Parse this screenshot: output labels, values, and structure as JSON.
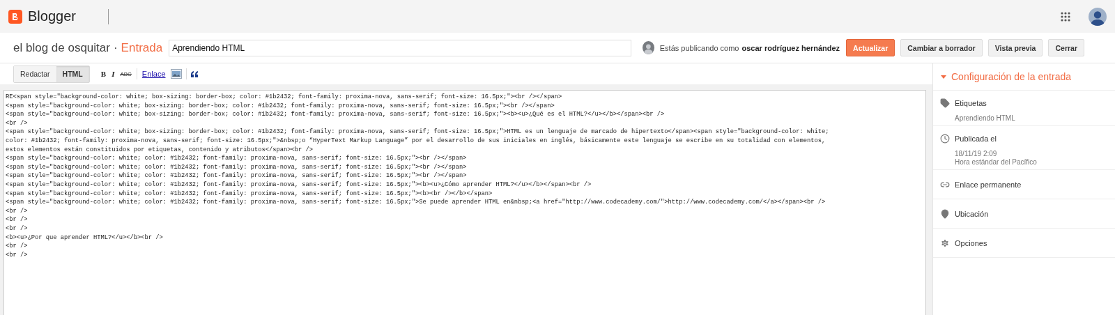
{
  "app_bar": {
    "brand": "Blogger"
  },
  "header": {
    "blog_name": "el blog de osquitar",
    "separator": "·",
    "section": "Entrada",
    "title_value": "Aprendiendo HTML",
    "publishing_prefix": "Estás publicando como",
    "publishing_name": "oscar rodríguez hernández",
    "buttons": [
      {
        "label": "Actualizar",
        "kind": "primary"
      },
      {
        "label": "Cambiar a borrador",
        "kind": "default"
      },
      {
        "label": "Vista previa",
        "kind": "default"
      },
      {
        "label": "Cerrar",
        "kind": "default"
      }
    ]
  },
  "toolbar": {
    "modes": [
      {
        "label": "Redactar",
        "selected": false
      },
      {
        "label": "HTML",
        "selected": true
      }
    ],
    "bold": "B",
    "italic": "I",
    "strike": "ABC",
    "link": "Enlace"
  },
  "editor": {
    "lines": [
      "RE<span style=\"background-color: white; box-sizing: border-box; color: #1b2432; font-family: proxima-nova, sans-serif; font-size: 16.5px;\"><br /></span>",
      "<span style=\"background-color: white; box-sizing: border-box; color: #1b2432; font-family: proxima-nova, sans-serif; font-size: 16.5px;\"><br /></span>",
      "<span style=\"background-color: white; box-sizing: border-box; color: #1b2432; font-family: proxima-nova, sans-serif; font-size: 16.5px;\"><b><u>¿Qué es el HTML?</u></b></span><br />",
      "<br />",
      "<span style=\"background-color: white; box-sizing: border-box; color: #1b2432; font-family: proxima-nova, sans-serif; font-size: 16.5px;\">HTML es un lenguaje de marcado de hipertexto</span><span style=\"background-color: white;",
      "color: #1b2432; font-family: proxima-nova, sans-serif; font-size: 16.5px;\">&nbsp;o “HyperText Markup Language” por el desarrollo de sus iniciales en inglés, básicamente este lenguaje se escribe en su totalidad con elementos,",
      "estos elementos están constituidos por etiquetas, contenido y atributos</span><br />",
      "<span style=\"background-color: white; color: #1b2432; font-family: proxima-nova, sans-serif; font-size: 16.5px;\"><br /></span>",
      "<span style=\"background-color: white; color: #1b2432; font-family: proxima-nova, sans-serif; font-size: 16.5px;\"><br /></span>",
      "<span style=\"background-color: white; color: #1b2432; font-family: proxima-nova, sans-serif; font-size: 16.5px;\"><br /></span>",
      "<span style=\"background-color: white; color: #1b2432; font-family: proxima-nova, sans-serif; font-size: 16.5px;\"><b><u>¿Cómo aprender HTML?</u></b></span><br />",
      "<span style=\"background-color: white; color: #1b2432; font-family: proxima-nova, sans-serif; font-size: 16.5px;\"><b><br /></b></span>",
      "<span style=\"background-color: white; color: #1b2432; font-family: proxima-nova, sans-serif; font-size: 16.5px;\">Se puede aprender HTML en&nbsp;<a href=\"http://www.codecademy.com/\">http://www.codecademy.com/</a></span><br />",
      "<br />",
      "<br />",
      "<br />",
      "<b><u>¿Por que aprender HTML?</u></b><br />",
      "<br />",
      "<br />"
    ]
  },
  "settings_panel": {
    "title": "Configuración de la entrada",
    "expanded": true,
    "sections": [
      {
        "kind": "labels",
        "heading": "Etiquetas",
        "details": [
          "Aprendiendo HTML"
        ]
      },
      {
        "kind": "published",
        "heading": "Publicada el",
        "details": [
          "18/11/19 2:09",
          "Hora estándar del Pacífico"
        ]
      },
      {
        "kind": "permalink",
        "heading": "Enlace permanente"
      },
      {
        "kind": "location",
        "heading": "Ubicación"
      },
      {
        "kind": "options",
        "heading": "Opciones"
      }
    ]
  }
}
